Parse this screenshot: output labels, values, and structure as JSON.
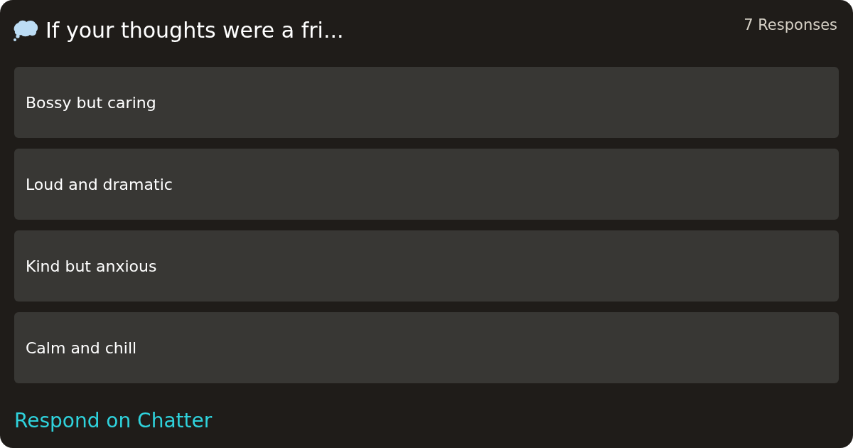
{
  "poll": {
    "title": "If your thoughts were a fri...",
    "response_count": "7 Responses"
  },
  "options": [
    {
      "label": "Bossy but caring"
    },
    {
      "label": "Loud and dramatic"
    },
    {
      "label": "Kind but anxious"
    },
    {
      "label": "Calm and chill"
    }
  ],
  "footer": {
    "link": "Respond on Chatter"
  }
}
